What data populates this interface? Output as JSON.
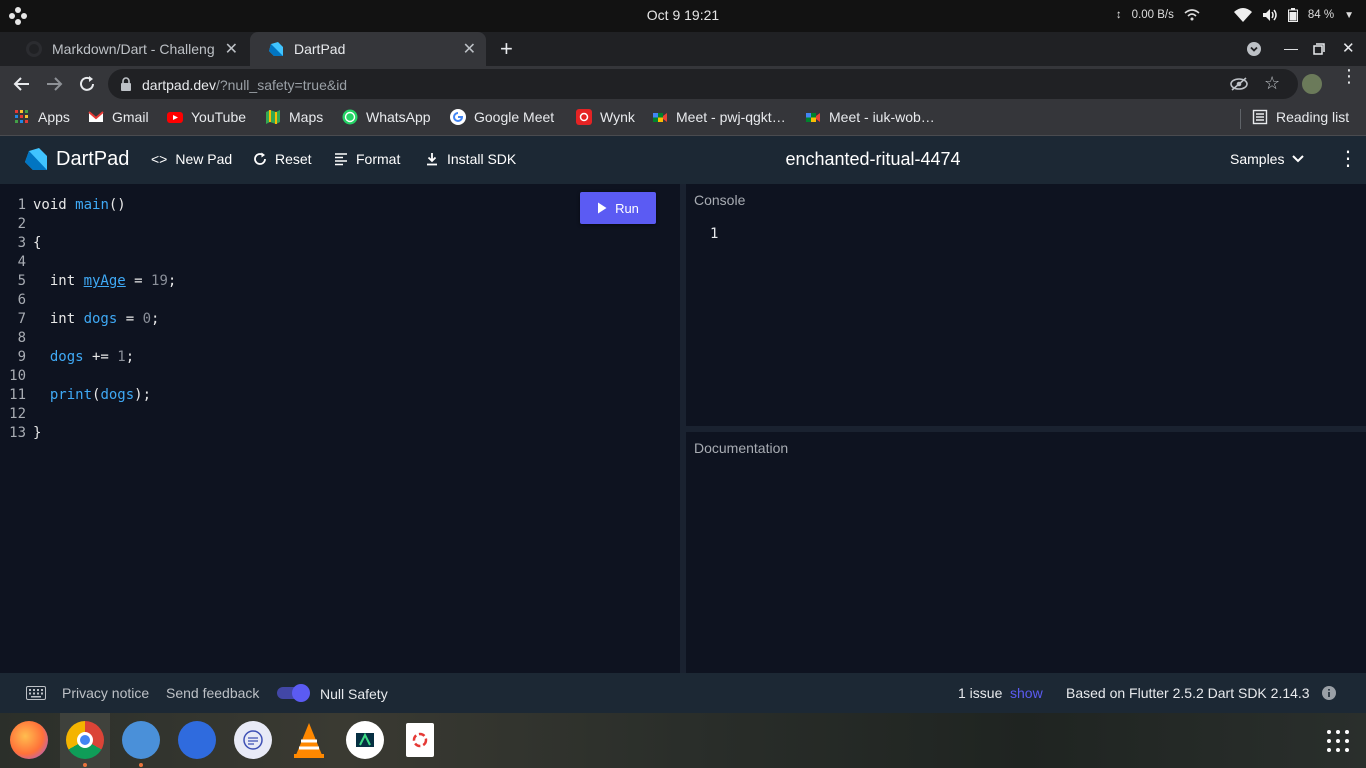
{
  "system": {
    "clock": "Oct 9  19:21",
    "net_speed": "0.00 B/s",
    "battery": "84 %"
  },
  "tabs": [
    {
      "title": "Markdown/Dart - Challeng",
      "close": "✕"
    },
    {
      "title": "DartPad",
      "close": "✕"
    }
  ],
  "new_tab": "+",
  "address": {
    "domain": "dartpad.dev",
    "path": "/?null_safety=true&id"
  },
  "bookmarks": [
    {
      "label": "Apps"
    },
    {
      "label": "Gmail"
    },
    {
      "label": "YouTube"
    },
    {
      "label": "Maps"
    },
    {
      "label": "WhatsApp"
    },
    {
      "label": "Google Meet"
    },
    {
      "label": "Wynk"
    },
    {
      "label": "Meet - pwj-qgkt…"
    },
    {
      "label": "Meet - iuk-wob…"
    }
  ],
  "reading_list": "Reading list",
  "dartpad": {
    "logo": "DartPad",
    "new_pad": "New Pad",
    "reset": "Reset",
    "format": "Format",
    "install_sdk": "Install SDK",
    "pad_title": "enchanted-ritual-4474",
    "samples": "Samples"
  },
  "editor": {
    "run": "Run",
    "line_numbers": [
      "1",
      "2",
      "3",
      "4",
      "5",
      "6",
      "7",
      "8",
      "9",
      "10",
      "11",
      "12",
      "13"
    ]
  },
  "console": {
    "title": "Console",
    "output": "1"
  },
  "documentation": {
    "title": "Documentation"
  },
  "footer": {
    "privacy": "Privacy notice",
    "feedback": "Send feedback",
    "null_safety": "Null Safety",
    "null_safety_on": true,
    "issues": "1 issue",
    "show": "show",
    "version": "Based on Flutter 2.5.2 Dart SDK 2.14.3"
  },
  "colors": {
    "accent": "#5b5bf3",
    "header_bg": "#1c2834",
    "editor_bg": "#0e1320",
    "identifier": "#3fa9f5"
  }
}
